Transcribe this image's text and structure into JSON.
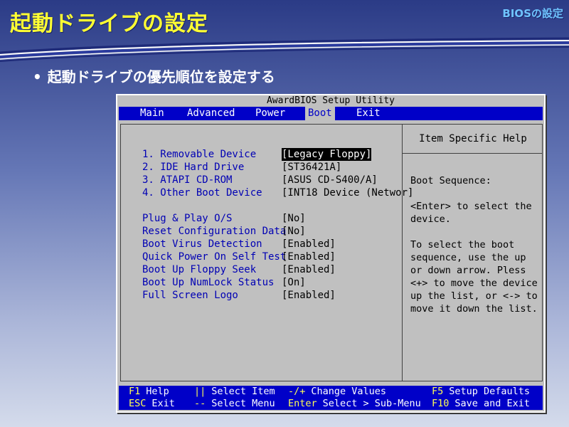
{
  "slide": {
    "title": "起動ドライブの設定",
    "tag": "BIOSの設定",
    "bullet": "起動ドライブの優先順位を設定する",
    "bullet_marker": "•"
  },
  "bios": {
    "window_title": "AwardBIOS Setup Utility",
    "menu": [
      {
        "label": "Main",
        "active": false
      },
      {
        "label": "Advanced",
        "active": false
      },
      {
        "label": "Power",
        "active": false
      },
      {
        "label": "Boot",
        "active": true
      },
      {
        "label": "Exit",
        "active": false
      }
    ],
    "settings": [
      {
        "label": "1. Removable Device",
        "value": "[Legacy Floppy]",
        "selected": true
      },
      {
        "label": "2. IDE Hard Drive",
        "value": "[ST36421A]",
        "selected": false
      },
      {
        "label": "3. ATAPI CD-ROM",
        "value": "[ASUS CD-S400/A]",
        "selected": false
      },
      {
        "label": "4. Other Boot Device",
        "value": "[INT18 Device (Networ]",
        "selected": false
      },
      {
        "label": "Plug & Play O/S",
        "value": "[No]",
        "selected": false
      },
      {
        "label": "Reset Configuration Data",
        "value": "[No]",
        "selected": false
      },
      {
        "label": "Boot Virus Detection",
        "value": "[Enabled]",
        "selected": false
      },
      {
        "label": "Quick Power On Self Test",
        "value": "[Enabled]",
        "selected": false
      },
      {
        "label": "Boot Up Floppy Seek",
        "value": "[Enabled]",
        "selected": false
      },
      {
        "label": "Boot Up NumLock Status",
        "value": "[On]",
        "selected": false
      },
      {
        "label": "Full Screen Logo",
        "value": "[Enabled]",
        "selected": false
      }
    ],
    "help": {
      "title": "Item Specific Help",
      "text": "Boot Sequence:\n\n<Enter> to select the device.\n\nTo select the boot sequence, use the up or down arrow. Pless <+> to move the device up the list, or <-> to move it down the list."
    },
    "footer": [
      {
        "key": "F1",
        "desc": "Help"
      },
      {
        "key": "||",
        "desc": "Select Item"
      },
      {
        "key": "-/+",
        "desc": "Change Values"
      },
      {
        "key": "F5",
        "desc": "Setup Defaults"
      },
      {
        "key": "ESC",
        "desc": "Exit"
      },
      {
        "key": "--",
        "desc": "Select Menu"
      },
      {
        "key": "Enter",
        "desc": "Select > Sub-Menu"
      },
      {
        "key": "F10",
        "desc": "Save and Exit"
      }
    ]
  },
  "colors": {
    "bios_blue": "#0000c8",
    "bios_gray": "#c0c0c0",
    "title_yellow": "#ffff33",
    "tag_cyan": "#6fc4ff"
  }
}
